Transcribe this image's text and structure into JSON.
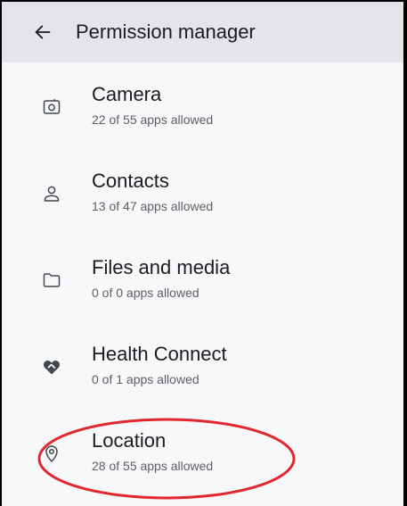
{
  "header": {
    "title": "Permission manager",
    "back_icon": "arrow-left-icon"
  },
  "permissions": [
    {
      "label": "Camera",
      "sub": "22 of 55 apps allowed",
      "icon": "camera-icon"
    },
    {
      "label": "Contacts",
      "sub": "13 of 47 apps allowed",
      "icon": "person-icon"
    },
    {
      "label": "Files and media",
      "sub": "0 of 0 apps allowed",
      "icon": "folder-icon"
    },
    {
      "label": "Health Connect",
      "sub": "0 of 1 apps allowed",
      "icon": "health-connect-icon"
    },
    {
      "label": "Location",
      "sub": "28 of 55 apps allowed",
      "icon": "location-pin-icon"
    }
  ],
  "colors": {
    "header_bg": "#e4e5e8",
    "background": "#f7f8fa",
    "text_primary": "#1b1c1f",
    "text_secondary": "#5d5f63",
    "annotation": "#e0282e"
  }
}
